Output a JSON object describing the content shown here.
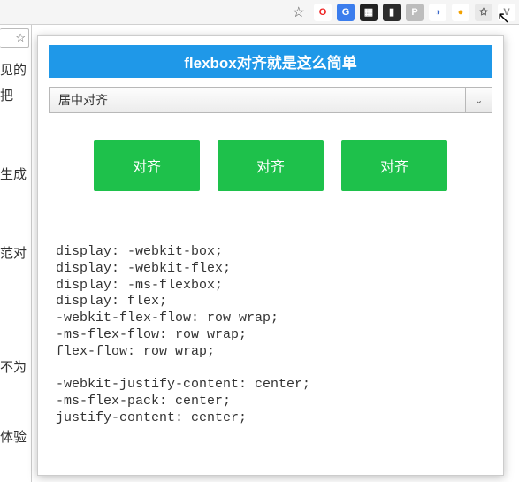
{
  "chrome": {
    "star": "☆",
    "icons": [
      {
        "name": "opera-icon",
        "bg": "#ffffff",
        "fg": "#e22",
        "glyph": "O"
      },
      {
        "name": "translate-icon",
        "bg": "#3b7ded",
        "fg": "#fff",
        "glyph": "G"
      },
      {
        "name": "qr-icon",
        "bg": "#222222",
        "fg": "#fff",
        "glyph": "▦"
      },
      {
        "name": "cat-icon",
        "bg": "#2b2b2b",
        "fg": "#fff",
        "glyph": "▮"
      },
      {
        "name": "p-icon",
        "bg": "#bdbdbd",
        "fg": "#fff",
        "glyph": "P"
      },
      {
        "name": "moon-icon",
        "bg": "#ffffff",
        "fg": "#3a67c9",
        "glyph": "◑"
      },
      {
        "name": "circle-icon",
        "bg": "#ffffff",
        "fg": "#f2a100",
        "glyph": "●"
      },
      {
        "name": "ext-star-icon",
        "bg": "#e8e8e8",
        "fg": "#555",
        "glyph": "✩"
      },
      {
        "name": "v-icon",
        "bg": "#ffffff",
        "fg": "#888",
        "glyph": "V"
      }
    ]
  },
  "sidebar": {
    "addr_tail": "☆",
    "items": [
      "见的",
      "把",
      "生成",
      "范对",
      "不为",
      "体验"
    ]
  },
  "popup": {
    "title": "flexbox对齐就是这么简单",
    "select": {
      "value": "居中对齐",
      "caret": "⌄"
    },
    "buttons": [
      "对齐",
      "对齐",
      "对齐"
    ],
    "code": "display: -webkit-box;\ndisplay: -webkit-flex;\ndisplay: -ms-flexbox;\ndisplay: flex;\n-webkit-flex-flow: row wrap;\n-ms-flex-flow: row wrap;\nflex-flow: row wrap;\n\n-webkit-justify-content: center;\n-ms-flex-pack: center;\njustify-content: center;"
  }
}
